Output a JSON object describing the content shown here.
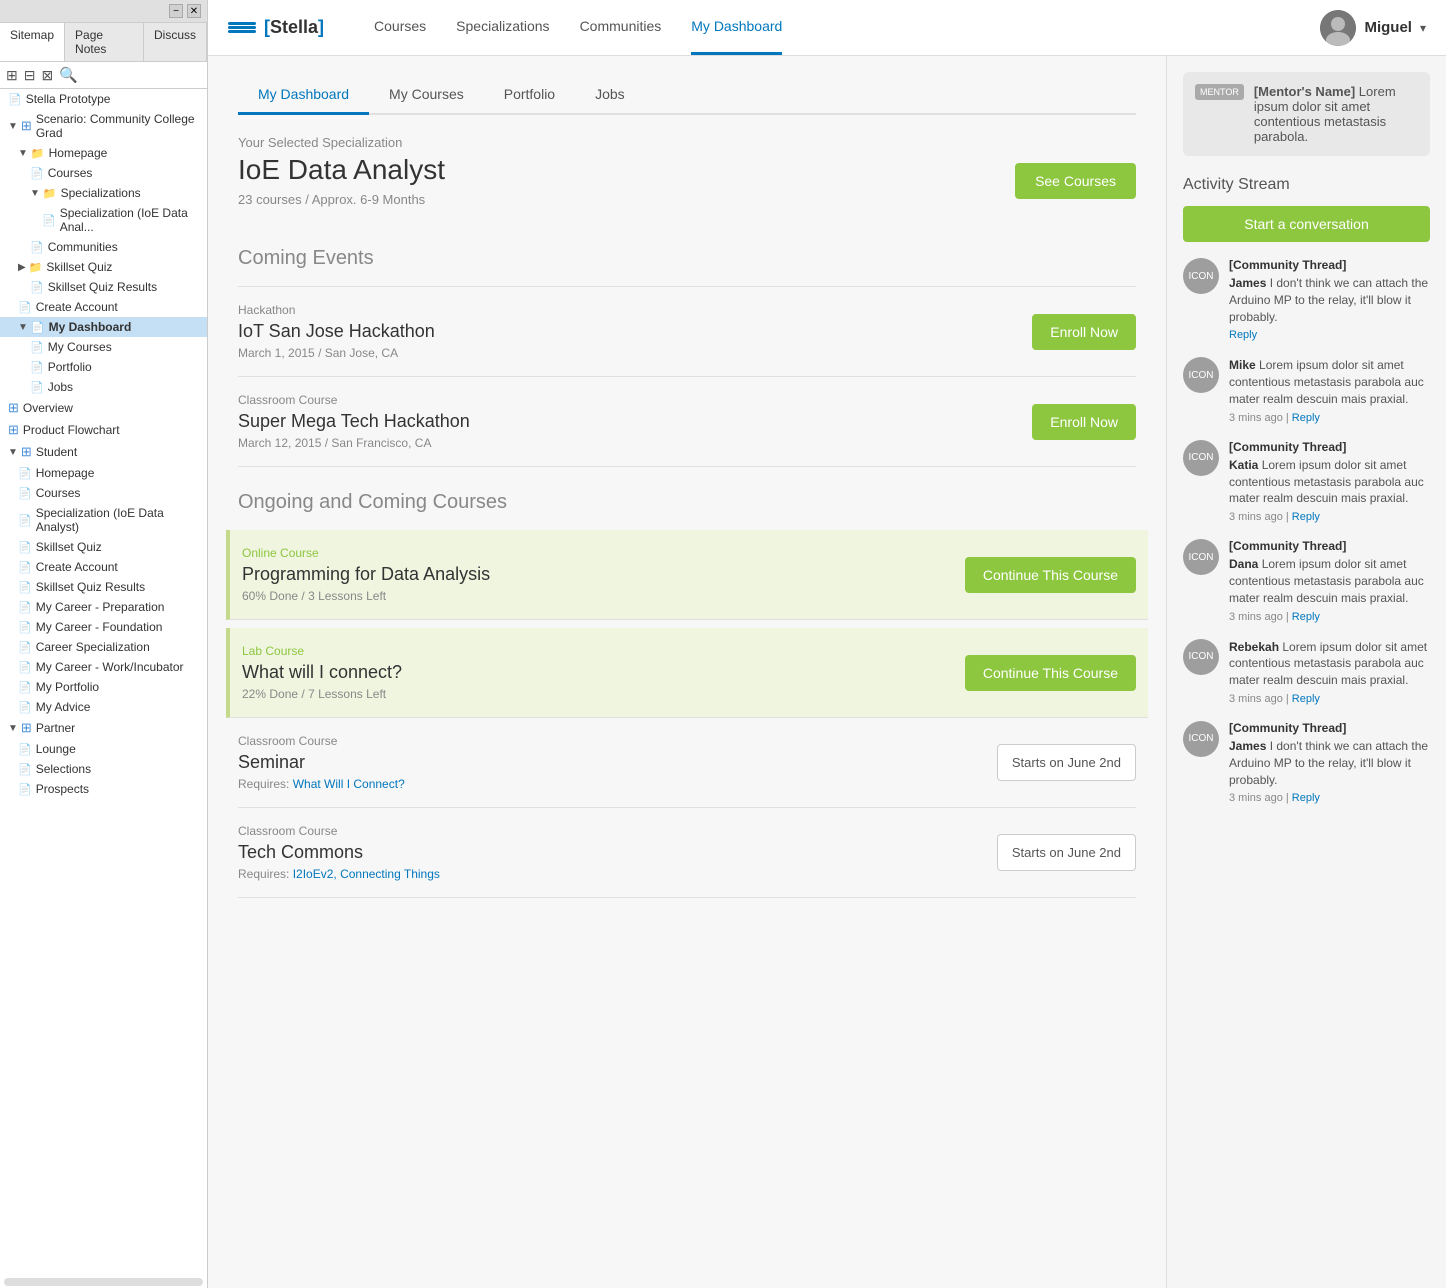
{
  "sidebar": {
    "tabs": [
      {
        "label": "Sitemap",
        "active": true
      },
      {
        "label": "Page Notes",
        "active": false
      },
      {
        "label": "Discuss",
        "active": false
      }
    ],
    "tree": [
      {
        "label": "Stella Prototype",
        "level": 0,
        "type": "page",
        "expanded": false
      },
      {
        "label": "Scenario: Community College Grad",
        "level": 0,
        "type": "section",
        "expanded": true
      },
      {
        "label": "Homepage",
        "level": 1,
        "type": "folder",
        "expanded": true
      },
      {
        "label": "Courses",
        "level": 2,
        "type": "page"
      },
      {
        "label": "Specializations",
        "level": 2,
        "type": "folder",
        "expanded": true
      },
      {
        "label": "Specialization (IoE Data Anal...",
        "level": 3,
        "type": "page"
      },
      {
        "label": "Communities",
        "level": 2,
        "type": "page"
      },
      {
        "label": "Skillset Quiz",
        "level": 1,
        "type": "folder",
        "expanded": false
      },
      {
        "label": "Skillset Quiz Results",
        "level": 2,
        "type": "page"
      },
      {
        "label": "Create Account",
        "level": 1,
        "type": "page"
      },
      {
        "label": "My Dashboard",
        "level": 1,
        "type": "page",
        "active": true
      },
      {
        "label": "My Courses",
        "level": 2,
        "type": "page"
      },
      {
        "label": "Portfolio",
        "level": 2,
        "type": "page"
      },
      {
        "label": "Jobs",
        "level": 2,
        "type": "page"
      },
      {
        "label": "Overview",
        "level": 0,
        "type": "section2"
      },
      {
        "label": "Product Flowchart",
        "level": 0,
        "type": "section2"
      },
      {
        "label": "Student",
        "level": 0,
        "type": "section",
        "expanded": true
      },
      {
        "label": "Homepage",
        "level": 1,
        "type": "page"
      },
      {
        "label": "Courses",
        "level": 1,
        "type": "page"
      },
      {
        "label": "Specialization (IoE Data Analyst)",
        "level": 1,
        "type": "page"
      },
      {
        "label": "Skillset Quiz",
        "level": 1,
        "type": "page"
      },
      {
        "label": "Create Account",
        "level": 1,
        "type": "page"
      },
      {
        "label": "Skillset Quiz Results",
        "level": 1,
        "type": "page"
      },
      {
        "label": "My Career - Preparation",
        "level": 1,
        "type": "page"
      },
      {
        "label": "My Career - Foundation",
        "level": 1,
        "type": "page"
      },
      {
        "label": "Career Specialization",
        "level": 1,
        "type": "page"
      },
      {
        "label": "My Career - Work/Incubator",
        "level": 1,
        "type": "page"
      },
      {
        "label": "My Portfolio",
        "level": 1,
        "type": "page"
      },
      {
        "label": "My Advice",
        "level": 1,
        "type": "page"
      },
      {
        "label": "Partner",
        "level": 0,
        "type": "section",
        "expanded": true
      },
      {
        "label": "Lounge",
        "level": 1,
        "type": "page"
      },
      {
        "label": "Selections",
        "level": 1,
        "type": "page"
      },
      {
        "label": "Prospects",
        "level": 1,
        "type": "page"
      }
    ]
  },
  "topnav": {
    "brand": "Stella",
    "links": [
      "Courses",
      "Specializations",
      "Communities",
      "My Dashboard"
    ],
    "active_link": "My Dashboard",
    "user_name": "Miguel"
  },
  "dashboard": {
    "tabs": [
      "My Dashboard",
      "My Courses",
      "Portfolio",
      "Jobs"
    ],
    "active_tab": "My Dashboard",
    "specialization": {
      "label": "Your Selected Specialization",
      "title": "IoE Data Analyst",
      "courses": "23 courses",
      "duration": "Approx. 6-9 Months",
      "btn": "See Courses"
    },
    "coming_events": {
      "heading": "Coming Events",
      "events": [
        {
          "type": "Hackathon",
          "title": "IoT San Jose Hackathon",
          "date": "March 1, 2015",
          "location": "San Jose, CA",
          "btn": "Enroll Now"
        },
        {
          "type": "Classroom Course",
          "title": "Super Mega Tech Hackathon",
          "date": "March 12, 2015",
          "location": "San Francisco, CA",
          "btn": "Enroll Now"
        }
      ]
    },
    "ongoing_courses": {
      "heading": "Ongoing and Coming Courses",
      "courses": [
        {
          "type": "Online Course",
          "title": "Programming for Data Analysis",
          "progress": "60% Done",
          "lessons_left": "3 Lessons Left",
          "btn": "Continue This Course",
          "btn_type": "continue",
          "highlighted": true
        },
        {
          "type": "Lab Course",
          "title": "What will I connect?",
          "progress": "22% Done",
          "lessons_left": "7 Lessons Left",
          "btn": "Continue This Course",
          "btn_type": "continue",
          "highlighted": true
        },
        {
          "type": "Classroom Course",
          "title": "Seminar",
          "requires_label": "Requires:",
          "requires": "What Will I Connect?",
          "btn": "Starts on June 2nd",
          "btn_type": "starts",
          "highlighted": false
        },
        {
          "type": "Classroom Course",
          "title": "Tech Commons",
          "requires_label": "Requires:",
          "requires": "I2IoEv2, Connecting Things",
          "btn": "Starts on June 2nd",
          "btn_type": "starts",
          "highlighted": false
        }
      ]
    }
  },
  "right_panel": {
    "mentor": {
      "label": "MENTOR",
      "name": "[Mentor's Name]",
      "text": "Lorem ipsum dolor sit amet contentious metastasis parabola."
    },
    "activity": {
      "heading": "Activity Stream",
      "start_btn": "Start a conversation",
      "items": [
        {
          "thread": "[Community Thread]",
          "user": "James",
          "text": "I don't think we can attach the Arduino MP to the relay, it'll blow it probably.",
          "time": "",
          "reply": "Reply"
        },
        {
          "thread": "",
          "user": "Mike",
          "text": "Lorem ipsum dolor sit amet contentious metastasis parabola auc mater realm descuin mais praxial.",
          "time": "3 mins ago",
          "reply": "Reply"
        },
        {
          "thread": "[Community Thread]",
          "user": "Katia",
          "text": "Lorem ipsum dolor sit amet contentious metastasis parabola auc mater realm descuin mais praxial.",
          "time": "3 mins ago",
          "reply": "Reply"
        },
        {
          "thread": "[Community Thread]",
          "user": "Dana",
          "text": "Lorem ipsum dolor sit amet contentious metastasis parabola auc mater realm descuin mais praxial.",
          "time": "3 mins ago",
          "reply": "Reply"
        },
        {
          "thread": "",
          "user": "Rebekah",
          "text": "Lorem ipsum dolor sit amet contentious metastasis parabola auc mater realm descuin mais praxial.",
          "time": "3 mins ago",
          "reply": "Reply"
        },
        {
          "thread": "[Community Thread]",
          "user": "James",
          "text": "I don't think we can attach the Arduino MP to the relay, it'll blow it probably.",
          "time": "3 mins ago",
          "reply": "Reply"
        }
      ]
    }
  }
}
